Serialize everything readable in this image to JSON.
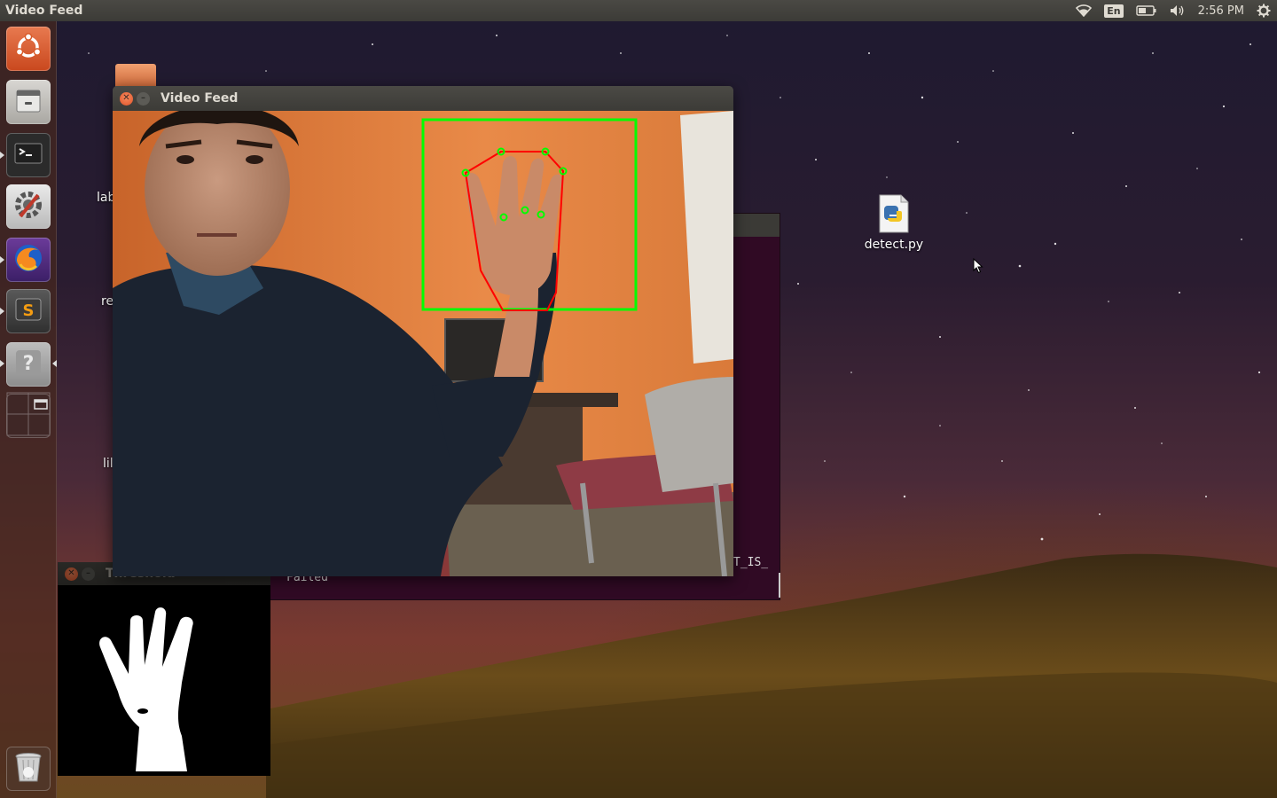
{
  "panel": {
    "app_title": "Video Feed",
    "keyboard_layout": "En",
    "clock": "2:56 PM"
  },
  "launcher": {
    "items": [
      {
        "name": "dash",
        "icon": "ubuntu-logo-icon"
      },
      {
        "name": "files",
        "icon": "file-cabinet-icon"
      },
      {
        "name": "terminal",
        "icon": "terminal-icon"
      },
      {
        "name": "system-settings",
        "icon": "gear-wrench-icon"
      },
      {
        "name": "firefox",
        "icon": "firefox-icon"
      },
      {
        "name": "sublime-text",
        "icon": "sublime-text-icon"
      },
      {
        "name": "help",
        "icon": "question-icon"
      },
      {
        "name": "workspace-switcher",
        "icon": "workspaces-icon"
      },
      {
        "name": "trash",
        "icon": "trash-icon"
      }
    ]
  },
  "desktop": {
    "file_name": "detect.py",
    "partial_labels": [
      "lab",
      "re",
      "lil"
    ]
  },
  "video_window": {
    "title": "Video Feed"
  },
  "threshold_window": {
    "title": "Threshold"
  },
  "terminal": {
    "line_right": "T_IS_",
    "line_bottom": "Failed"
  },
  "colors": {
    "bounding_box": "#00ff00",
    "hull": "#ff0000",
    "keypoints": "#00ff00",
    "close_button": "#e95420"
  }
}
